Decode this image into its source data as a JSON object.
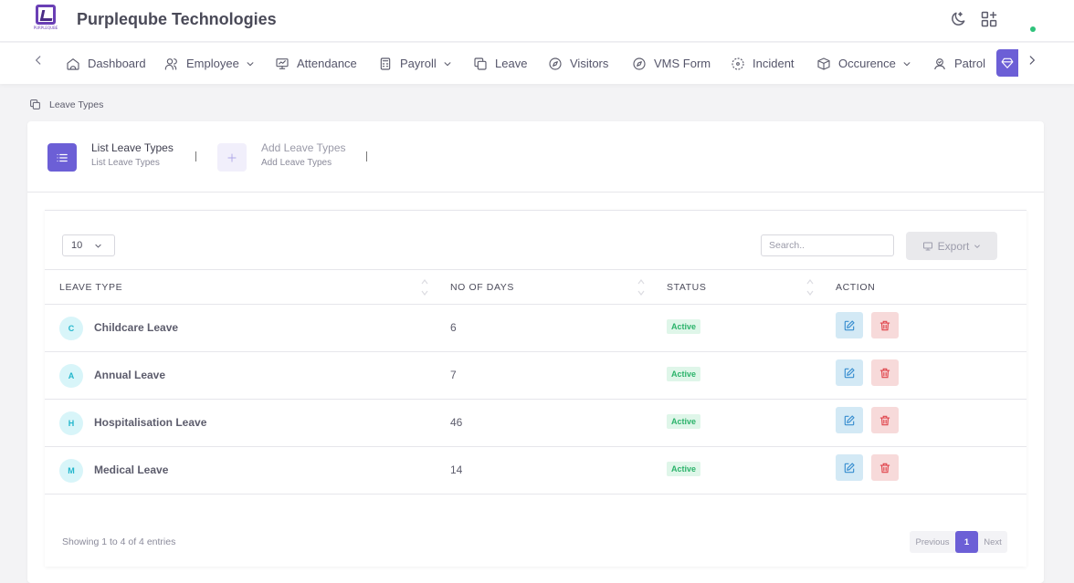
{
  "app": {
    "logo_text": "PURPLEQUBE",
    "title": "Purpleqube Technologies"
  },
  "nav": {
    "items": [
      {
        "label": "Dashboard",
        "icon": "home-icon"
      },
      {
        "label": "Employee",
        "icon": "users-icon"
      },
      {
        "label": "Attendance",
        "icon": "presentation-icon"
      },
      {
        "label": "Payroll",
        "icon": "calculator-icon"
      },
      {
        "label": "Leave",
        "icon": "copy-icon"
      },
      {
        "label": "Visitors",
        "icon": "compass-icon"
      },
      {
        "label": "VMS Form",
        "icon": "compass-icon"
      },
      {
        "label": "Incident",
        "icon": "target-icon"
      },
      {
        "label": "Occurence",
        "icon": "box-icon"
      },
      {
        "label": "Patrol",
        "icon": "user-shield-icon"
      }
    ]
  },
  "breadcrumb": {
    "label": "Leave Types"
  },
  "tabs": [
    {
      "title": "List Leave Types",
      "subtitle": "List Leave Types"
    },
    {
      "title": "Add Leave Types",
      "subtitle": "Add Leave Types"
    }
  ],
  "table_controls": {
    "page_length": "10",
    "search_placeholder": "Search..",
    "export_label": "Export"
  },
  "table": {
    "columns": [
      "LEAVE TYPE",
      "NO OF DAYS",
      "STATUS",
      "ACTION"
    ],
    "rows": [
      {
        "initial": "C",
        "name": "Childcare Leave",
        "days": "6",
        "status": "Active"
      },
      {
        "initial": "A",
        "name": "Annual Leave",
        "days": "7",
        "status": "Active"
      },
      {
        "initial": "H",
        "name": "Hospitalisation Leave",
        "days": "46",
        "status": "Active"
      },
      {
        "initial": "M",
        "name": "Medical Leave",
        "days": "14",
        "status": "Active"
      }
    ]
  },
  "footer": {
    "info": "Showing 1 to 4 of 4 entries",
    "previous": "Previous",
    "page": "1",
    "next": "Next"
  },
  "colors": {
    "primary": "#6c5fd6",
    "active_badge_bg": "#dff6e9",
    "active_badge_text": "#2bb36a",
    "avatar_bg": "#d8f5f9",
    "avatar_text": "#22b6cc",
    "edit_bg": "#d3e9f5",
    "delete_bg": "#f7dada",
    "online": "#2fc27b"
  }
}
